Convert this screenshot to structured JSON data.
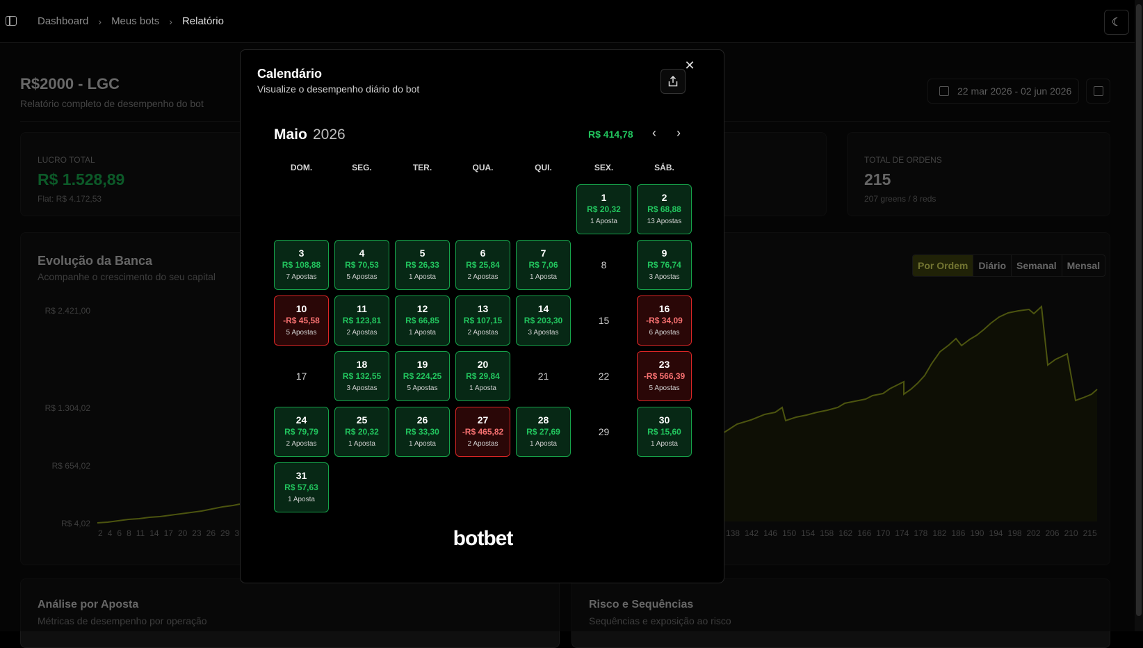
{
  "breadcrumb": {
    "items": [
      "Dashboard",
      "Meus bots",
      "Relatório"
    ]
  },
  "theme_toggle": {
    "icon": "moon-icon"
  },
  "page": {
    "title": "R$2000 - LGC",
    "subtitle": "Relatório completo de desempenho do bot",
    "date_range": "22 mar 2026 - 02 jun 2026"
  },
  "stats": {
    "profit": {
      "label": "LUCRO TOTAL",
      "value": "R$ 1.528,89",
      "footer": "Flat: R$ 4.172,53",
      "color": "#16a34a"
    },
    "orders": {
      "label": "TOTAL DE ORDENS",
      "value": "215",
      "footer": "207 greens / 8 reds"
    }
  },
  "evolution": {
    "title": "Evolução da Banca",
    "subtitle": "Acompanhe o crescimento do seu capital",
    "y_ticks": [
      "R$ 2.421,00",
      "R$ 1.304,02",
      "R$ 654,02",
      "R$ 4,02"
    ],
    "x_ticks_left": [
      "2",
      "4",
      "6",
      "8",
      "11",
      "14",
      "17",
      "20",
      "23",
      "26",
      "29",
      "3"
    ],
    "x_ticks_right": [
      "138",
      "142",
      "146",
      "150",
      "154",
      "158",
      "162",
      "166",
      "170",
      "174",
      "178",
      "182",
      "186",
      "190",
      "194",
      "198",
      "202",
      "206",
      "210",
      "215"
    ],
    "tabs": [
      "Por Ordem",
      "Diário",
      "Semanal",
      "Mensal"
    ],
    "line_color": "#8a9a1c"
  },
  "bottom": {
    "left": {
      "title": "Análise por Aposta",
      "subtitle": "Métricas de desempenho por operação"
    },
    "right": {
      "title": "Risco e Sequências",
      "subtitle": "Sequências e exposição ao risco"
    }
  },
  "modal": {
    "title": "Calendário",
    "subtitle": "Visualize o desempenho diário do bot",
    "month": "Maio",
    "year": "2026",
    "month_total": "R$ 414,78",
    "weekdays": [
      "DOM.",
      "SEG.",
      "TER.",
      "QUA.",
      "QUI.",
      "SEX.",
      "SÁB."
    ],
    "leading_blanks": 5,
    "days": [
      {
        "day": "1",
        "amount": "R$ 20,32",
        "count": "1 Aposta",
        "status": "pos"
      },
      {
        "day": "2",
        "amount": "R$ 68,88",
        "count": "13 Apostas",
        "status": "pos"
      },
      {
        "day": "3",
        "amount": "R$ 108,88",
        "count": "7 Apostas",
        "status": "pos"
      },
      {
        "day": "4",
        "amount": "R$ 70,53",
        "count": "5 Apostas",
        "status": "pos"
      },
      {
        "day": "5",
        "amount": "R$ 26,33",
        "count": "1 Aposta",
        "status": "pos"
      },
      {
        "day": "6",
        "amount": "R$ 25,84",
        "count": "2 Apostas",
        "status": "pos"
      },
      {
        "day": "7",
        "amount": "R$ 7,06",
        "count": "1 Aposta",
        "status": "pos"
      },
      {
        "day": "8",
        "amount": "",
        "count": "",
        "status": "plain"
      },
      {
        "day": "9",
        "amount": "R$ 76,74",
        "count": "3 Apostas",
        "status": "pos"
      },
      {
        "day": "10",
        "amount": "-R$ 45,58",
        "count": "5 Apostas",
        "status": "neg"
      },
      {
        "day": "11",
        "amount": "R$ 123,81",
        "count": "2 Apostas",
        "status": "pos"
      },
      {
        "day": "12",
        "amount": "R$ 66,85",
        "count": "1 Aposta",
        "status": "pos"
      },
      {
        "day": "13",
        "amount": "R$ 107,15",
        "count": "2 Apostas",
        "status": "pos"
      },
      {
        "day": "14",
        "amount": "R$ 203,30",
        "count": "3 Apostas",
        "status": "pos"
      },
      {
        "day": "15",
        "amount": "",
        "count": "",
        "status": "plain"
      },
      {
        "day": "16",
        "amount": "-R$ 34,09",
        "count": "6 Apostas",
        "status": "neg"
      },
      {
        "day": "17",
        "amount": "",
        "count": "",
        "status": "plain"
      },
      {
        "day": "18",
        "amount": "R$ 132,55",
        "count": "3 Apostas",
        "status": "pos"
      },
      {
        "day": "19",
        "amount": "R$ 224,25",
        "count": "5 Apostas",
        "status": "pos"
      },
      {
        "day": "20",
        "amount": "R$ 29,84",
        "count": "1 Aposta",
        "status": "pos"
      },
      {
        "day": "21",
        "amount": "",
        "count": "",
        "status": "plain"
      },
      {
        "day": "22",
        "amount": "",
        "count": "",
        "status": "plain"
      },
      {
        "day": "23",
        "amount": "-R$ 566,39",
        "count": "5 Apostas",
        "status": "neg"
      },
      {
        "day": "24",
        "amount": "R$ 79,79",
        "count": "2 Apostas",
        "status": "pos"
      },
      {
        "day": "25",
        "amount": "R$ 20,32",
        "count": "1 Aposta",
        "status": "pos"
      },
      {
        "day": "26",
        "amount": "R$ 33,30",
        "count": "1 Aposta",
        "status": "pos"
      },
      {
        "day": "27",
        "amount": "-R$ 465,82",
        "count": "2 Apostas",
        "status": "neg"
      },
      {
        "day": "28",
        "amount": "R$ 27,69",
        "count": "1 Aposta",
        "status": "pos"
      },
      {
        "day": "29",
        "amount": "",
        "count": "",
        "status": "plain"
      },
      {
        "day": "30",
        "amount": "R$ 15,60",
        "count": "1 Aposta",
        "status": "pos"
      },
      {
        "day": "31",
        "amount": "R$ 57,63",
        "count": "1 Aposta",
        "status": "pos"
      }
    ],
    "logo": "botbet"
  }
}
